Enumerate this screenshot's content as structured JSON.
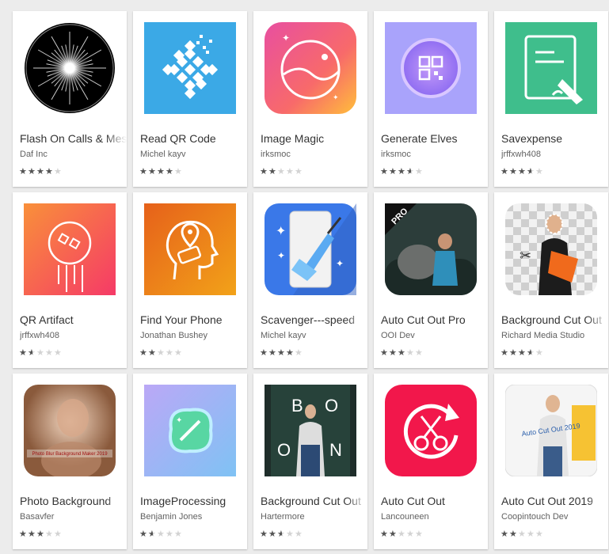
{
  "apps": [
    {
      "title": "Flash On Calls & Messages",
      "developer": "Daf Inc",
      "rating": 4,
      "icon": "flash-star-burst-icon",
      "bg": "#000000"
    },
    {
      "title": "Read QR Code",
      "developer": "Michel kayv",
      "rating": 4,
      "icon": "qr-diamond-icon",
      "bg": "#3ba9e6"
    },
    {
      "title": "Image Magic",
      "developer": "irksmoc",
      "rating": 2,
      "icon": "landscape-gradient-icon",
      "bg": "#f2528c"
    },
    {
      "title": "Generate Elves",
      "developer": "irksmoc",
      "rating": 3.5,
      "icon": "qr-circle-icon",
      "bg": "#9c82f5"
    },
    {
      "title": "Savexpense",
      "developer": "jrffxwh408",
      "rating": 3.5,
      "icon": "notebook-pen-icon",
      "bg": "#3fbe8c"
    },
    {
      "title": "QR Artifact",
      "developer": "jrffxwh408",
      "rating": 1.5,
      "icon": "qr-rocket-icon",
      "bg": "#f96a30"
    },
    {
      "title": "Find Your Phone",
      "developer": "Jonathan Bushey",
      "rating": 2,
      "icon": "head-location-icon",
      "bg": "#f07a1c"
    },
    {
      "title": "Scavenger---speed",
      "developer": "Michel kayv",
      "rating": 4,
      "icon": "phone-broom-icon",
      "bg": "#3a78e8"
    },
    {
      "title": "Auto Cut Out Pro",
      "developer": "OOI Dev",
      "rating": 3,
      "icon": "photo-woman-elephant-icon",
      "bg": "#2c3d3a"
    },
    {
      "title": "Background Cut Out",
      "developer": "Richard Media Studio",
      "rating": 3.5,
      "icon": "cutout-woman-icon",
      "bg": "#dddddd"
    },
    {
      "title": "Photo Background",
      "developer": "Basavfer",
      "rating": 3,
      "icon": "blurred-portrait-icon",
      "bg": "#b98c6a"
    },
    {
      "title": "ImageProcessing",
      "developer": "Benjamin Jones",
      "rating": 1.5,
      "icon": "magic-wand-blob-icon",
      "bg": "#b9abf4"
    },
    {
      "title": "Background Cut Out",
      "developer": "Hartermore",
      "rating": 2.5,
      "icon": "boom-poster-icon",
      "bg": "#1f2d2a"
    },
    {
      "title": "Auto Cut Out",
      "developer": "Lancouneen",
      "rating": 2,
      "icon": "scissors-refresh-icon",
      "bg": "#f2174b"
    },
    {
      "title": "Auto Cut Out 2019",
      "developer": "Coopintouch Dev",
      "rating": 2,
      "icon": "auto-cut-out-2019-poster-icon",
      "bg": "#f5f5f5"
    }
  ],
  "icon_texts": {
    "pro_badge": "PRO",
    "blur_caption": "Photo Blur Background Maker 2019",
    "boom_letters": [
      "B",
      "O",
      "O",
      "N"
    ],
    "poster_caption": "Auto Cut Out 2019"
  }
}
